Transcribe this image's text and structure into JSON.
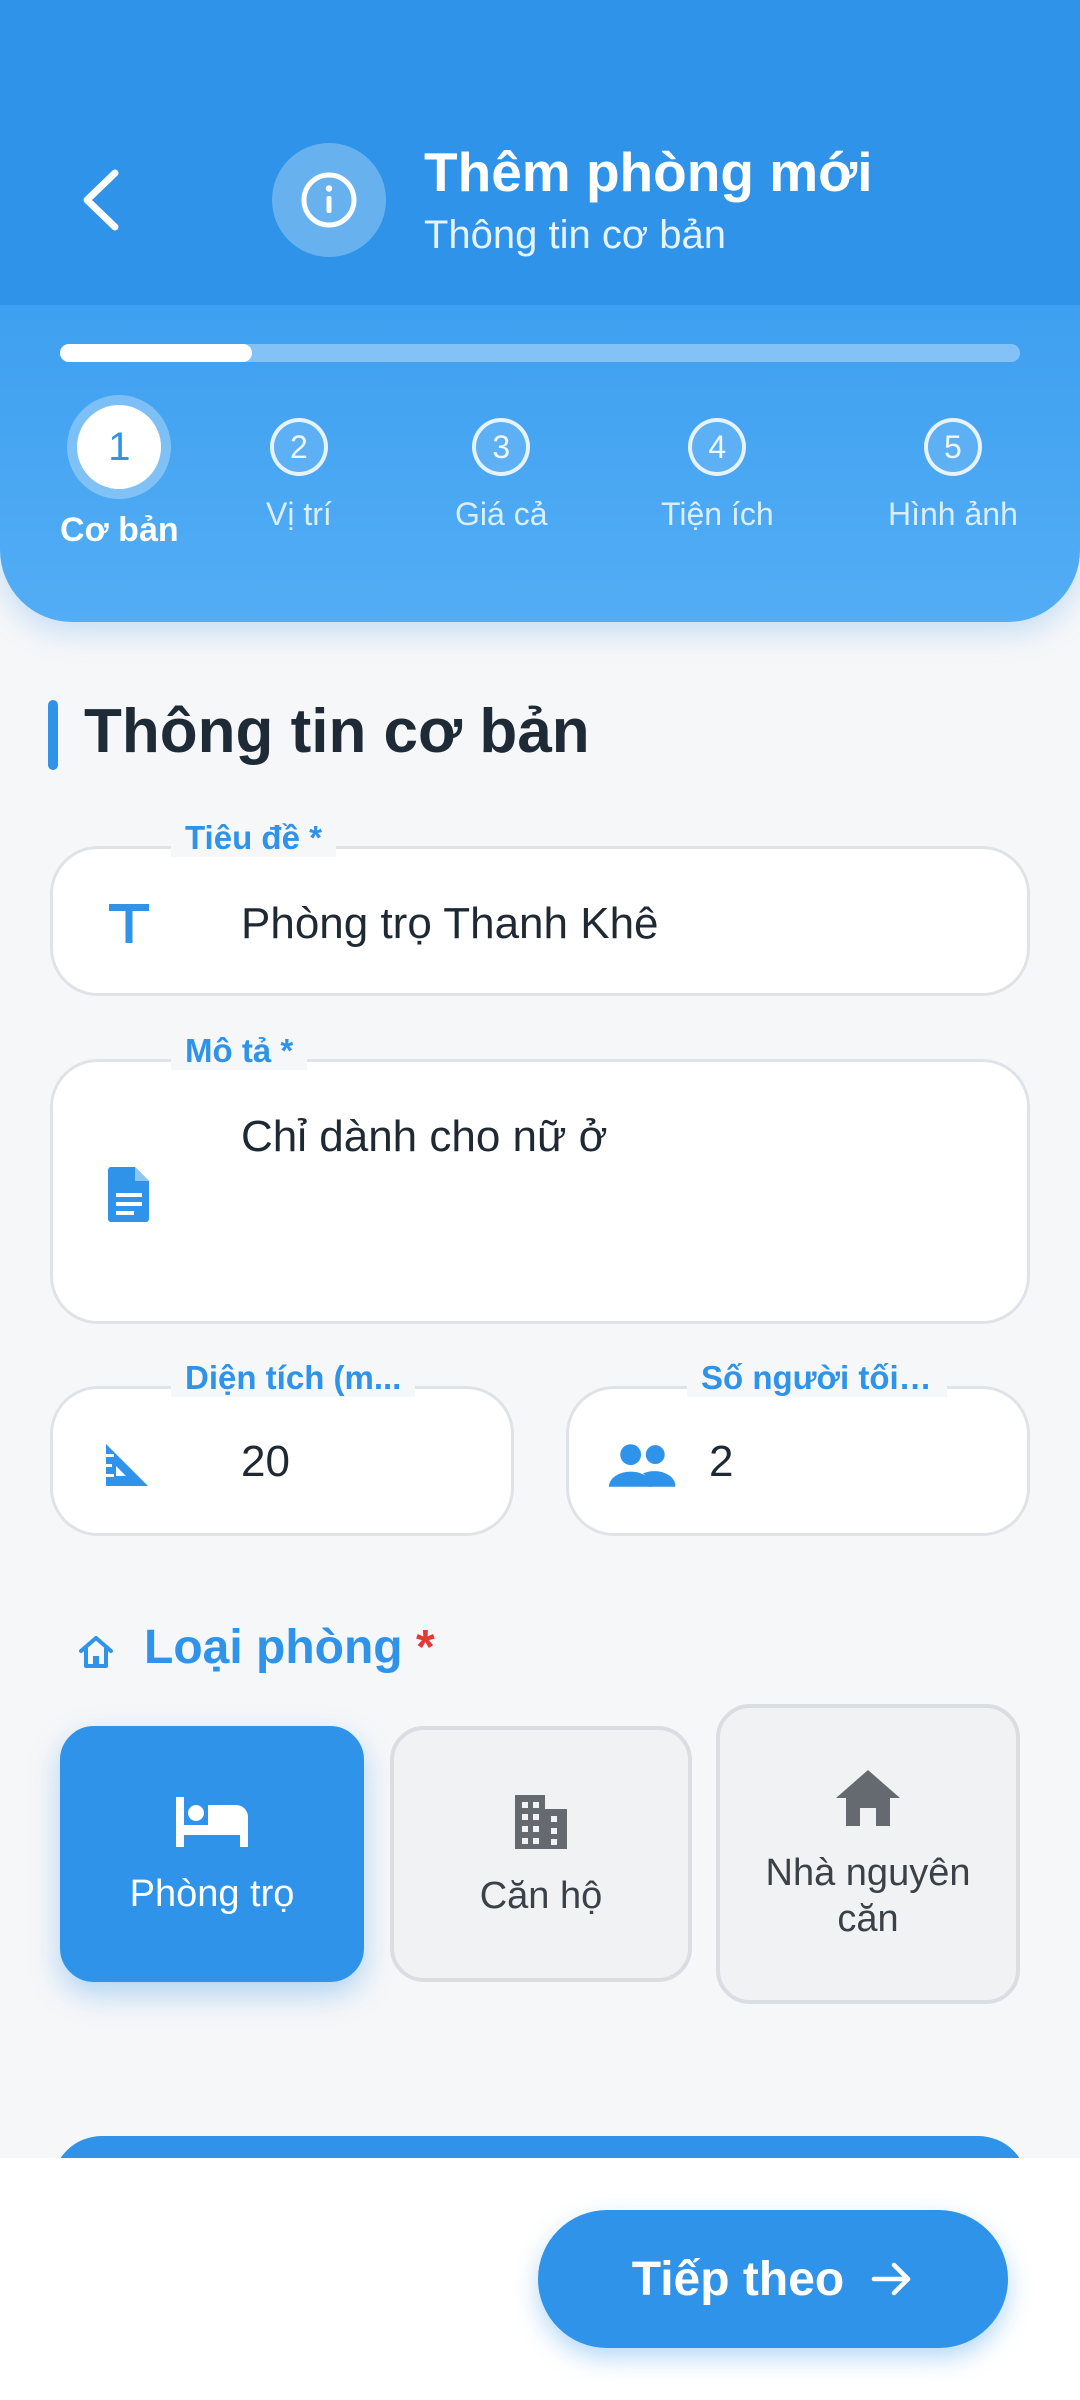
{
  "header": {
    "title": "Thêm phòng mới",
    "subtitle": "Thông tin cơ bản",
    "progress_fraction": 0.2
  },
  "steps": [
    {
      "number": "1",
      "label": "Cơ bản",
      "active": true
    },
    {
      "number": "2",
      "label": "Vị trí",
      "active": false
    },
    {
      "number": "3",
      "label": "Giá cả",
      "active": false
    },
    {
      "number": "4",
      "label": "Tiện ích",
      "active": false
    },
    {
      "number": "5",
      "label": "Hình ảnh",
      "active": false
    }
  ],
  "section": {
    "title": "Thông tin cơ bản"
  },
  "fields": {
    "title": {
      "label": "Tiêu đề *",
      "value": "Phòng trọ Thanh Khê",
      "icon": "text-icon"
    },
    "description": {
      "label": "Mô tả *",
      "value": "Chỉ dành cho nữ ở",
      "icon": "document-icon"
    },
    "area": {
      "label": "Diện tích (m...",
      "value": "20",
      "icon": "ruler-icon"
    },
    "max_people": {
      "label": "Số người tối ...",
      "value": "2",
      "icon": "people-icon"
    }
  },
  "room_type": {
    "label": "Loại phòng",
    "required_mark": "*",
    "options": [
      {
        "label": "Phòng trọ",
        "icon": "bed-icon",
        "selected": true
      },
      {
        "label": "Căn hộ",
        "icon": "building-icon",
        "selected": false
      },
      {
        "label": "Nhà nguyên căn",
        "icon": "house-icon",
        "selected": false
      }
    ]
  },
  "footer": {
    "next_label": "Tiếp theo"
  },
  "colors": {
    "primary": "#2e93e9",
    "required": "#e53935",
    "background": "#f6f7f9"
  }
}
